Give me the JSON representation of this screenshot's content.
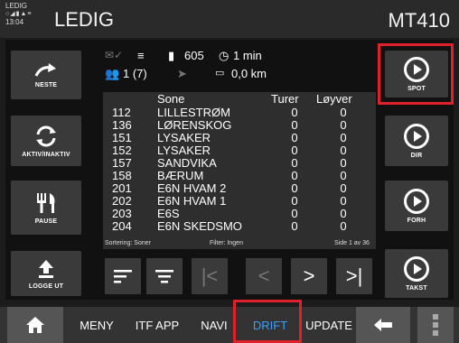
{
  "top": {
    "mini_status": "LEDIG",
    "mini_time": "13:04",
    "mini_icons": "○◢▮▲≡",
    "status": "LEDIG",
    "vehicle": "MT410"
  },
  "info": {
    "map_count": "605",
    "time": "1 min",
    "people": "1 (7)",
    "distance": "0,0 km"
  },
  "left_buttons": [
    {
      "label": "NESTE"
    },
    {
      "label": "AKTIV/INAKTIV"
    },
    {
      "label": "PAUSE"
    },
    {
      "label": "LOGGE UT"
    }
  ],
  "right_buttons": [
    {
      "label": "SPOT"
    },
    {
      "label": "DIR"
    },
    {
      "label": "FORH"
    },
    {
      "label": "TAKST"
    }
  ],
  "table": {
    "headers": {
      "zone": "Sone",
      "turer": "Turer",
      "loyver": "Løyver"
    },
    "rows": [
      {
        "id": "112",
        "zone": "LILLESTRØM",
        "turer": "0",
        "loyver": "0"
      },
      {
        "id": "136",
        "zone": "LØRENSKOG",
        "turer": "0",
        "loyver": "0"
      },
      {
        "id": "151",
        "zone": "LYSAKER",
        "turer": "0",
        "loyver": "0"
      },
      {
        "id": "152",
        "zone": "LYSAKER",
        "turer": "0",
        "loyver": "0"
      },
      {
        "id": "157",
        "zone": "SANDVIKA",
        "turer": "0",
        "loyver": "0"
      },
      {
        "id": "158",
        "zone": "BÆRUM",
        "turer": "0",
        "loyver": "0"
      },
      {
        "id": "201",
        "zone": "E6N HVAM 2",
        "turer": "0",
        "loyver": "0"
      },
      {
        "id": "202",
        "zone": "E6N HVAM 1",
        "turer": "0",
        "loyver": "0"
      },
      {
        "id": "203",
        "zone": "E6S",
        "turer": "0",
        "loyver": "0"
      },
      {
        "id": "204",
        "zone": "E6N SKEDSMO",
        "turer": "0",
        "loyver": "0"
      }
    ],
    "sort": "Sortering: Soner",
    "filter": "Filter: Ingen",
    "page": "Side 1 av 36"
  },
  "nav": {
    "meny": "MENY",
    "itf_app": "ITF APP",
    "navi": "NAVI",
    "drift": "DRIFT",
    "update": "UPDATE"
  },
  "colors": {
    "highlight": "#e0202a",
    "active_tab": "#3aa0ff"
  }
}
